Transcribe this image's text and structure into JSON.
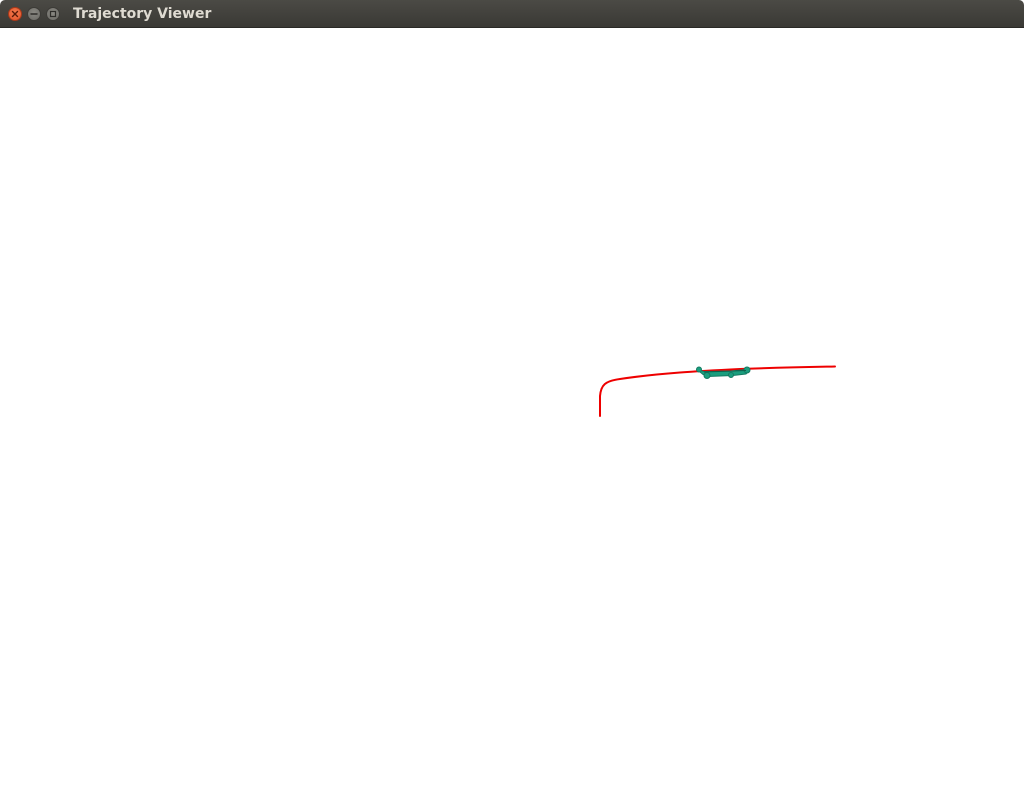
{
  "window": {
    "title": "Trajectory Viewer",
    "buttons": {
      "close_icon": "close-icon",
      "minimize_icon": "minimize-icon",
      "maximize_icon": "maximize-icon"
    }
  },
  "viewer": {
    "background": "#ffffff",
    "trajectory_color": "#ee0000",
    "vehicle_color": "#1a9e7e"
  }
}
